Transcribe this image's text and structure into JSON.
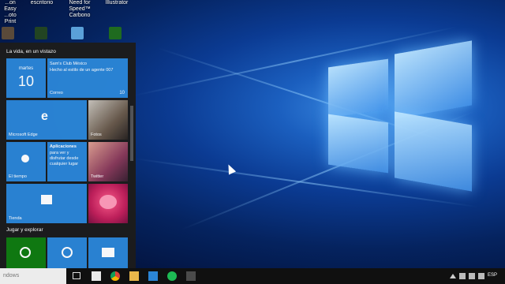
{
  "desktop_icons": [
    {
      "label": "...on Easy\n...oto Print"
    },
    {
      "label": "escritorio"
    },
    {
      "label": "Need for Speed™\nCarbono"
    },
    {
      "label": "Illustrator"
    }
  ],
  "start_menu": {
    "section1": "La vida, en un vistazo",
    "section2": "Jugar y explorar",
    "calendar": {
      "day": "martes",
      "date": "10"
    },
    "mail": {
      "sender": "Sam's Club México",
      "preview": "Hecho al estilo de un agente 007",
      "app": "Correo",
      "count": "10"
    },
    "edge": {
      "label": "Microsoft Edge"
    },
    "photos": {
      "label": "Fotos"
    },
    "weather": {
      "label": "El tiempo"
    },
    "apps": {
      "title": "Aplicaciones",
      "line1": "para ver y",
      "line2": "disfrutar desde",
      "line3": "cualquier lugar"
    },
    "twitter": {
      "label": "Twitter"
    },
    "store": {
      "label": "Tienda"
    }
  },
  "taskbar": {
    "search_text": "ndows",
    "language": "ESP"
  },
  "colors": {
    "accent": "#2b85d6",
    "xbox": "#107c10",
    "menu_bg": "#1c1c1c"
  }
}
